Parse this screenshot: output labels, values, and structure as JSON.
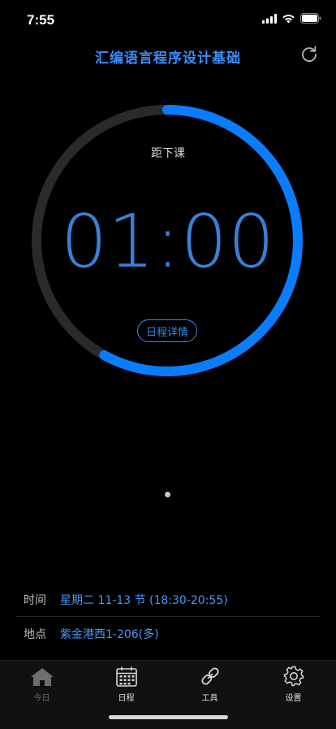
{
  "status_bar": {
    "time": "7:55",
    "icons": [
      "signal-icon",
      "wifi-icon",
      "battery-icon"
    ]
  },
  "nav": {
    "title": "汇编语言程序设计基础",
    "refresh_icon": "refresh-icon"
  },
  "countdown": {
    "label": "距下课",
    "time": "01:00",
    "progress_fraction": 0.58,
    "detail_button": "日程详情"
  },
  "pager": {
    "pages": 1,
    "current": 1
  },
  "info": {
    "time_label": "时间",
    "time_value": "星期二 11-13 节 (18:30-20:55)",
    "location_label": "地点",
    "location_value": "紫金港西1-206(多)"
  },
  "tabs": [
    {
      "label": "今日",
      "icon": "home-icon",
      "active": false
    },
    {
      "label": "日程",
      "icon": "calendar-icon",
      "active": true
    },
    {
      "label": "工具",
      "icon": "link-icon",
      "active": true
    },
    {
      "label": "设置",
      "icon": "gear-icon",
      "active": true
    }
  ],
  "colors": {
    "accent": "#0a7cff",
    "track": "#2a2a2a",
    "background": "#000000"
  }
}
